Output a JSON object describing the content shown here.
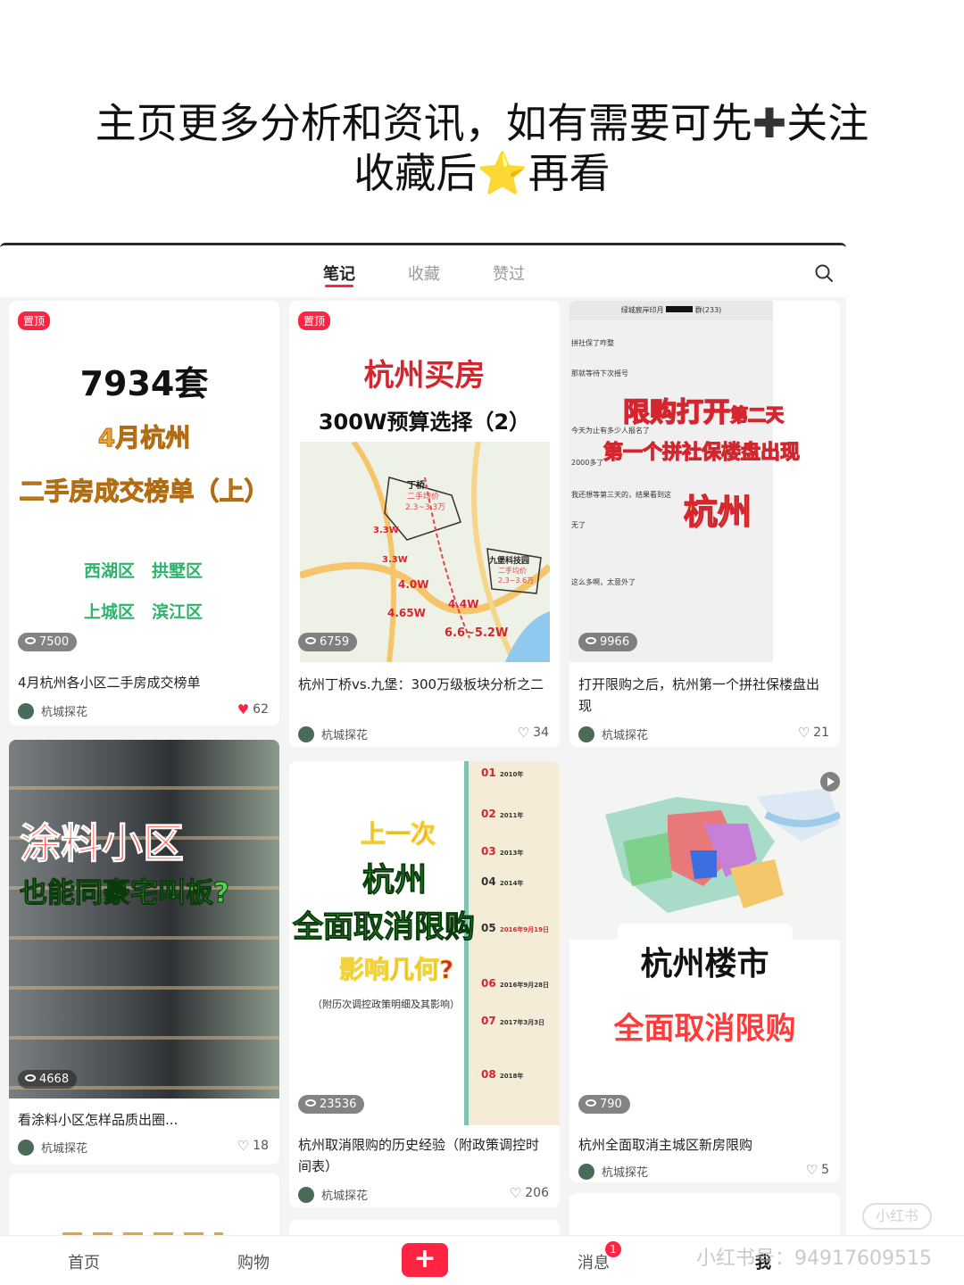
{
  "banner": {
    "line1_a": "主页更多分析和资讯，如有需要可先",
    "line1_plus": "✚",
    "line1_b": "关注",
    "line2_a": "收藏后",
    "line2_star": "⭐",
    "line2_b": "再看"
  },
  "tabs": [
    "笔记",
    "收藏",
    "赞过"
  ],
  "search_icon": "search-icon",
  "cards": [
    {
      "pin": "置顶",
      "cover": {
        "big": "7934套",
        "sub1": "4月杭州",
        "sub2": "二手房成交榜单（上）",
        "d1": "西湖区",
        "d2": "拱墅区",
        "d3": "上城区",
        "d4": "滨江区"
      },
      "views": "7500",
      "title": "4月杭州各小区二手房成交榜单",
      "author": "杭城探花",
      "likes": "62"
    },
    {
      "pin": "置顶",
      "cover": {
        "big": "杭州买房",
        "sub": "300W预算选择（2）",
        "m1": "丁桥",
        "m2": "二手均价",
        "m3": "2.3~3.3万",
        "m4": "3.3W",
        "m5": "3.3W",
        "m6": "4.0W",
        "m7": "4.65W",
        "m8": "4.4W",
        "m9": "6.6~5.2W",
        "m10": "九堡科技园",
        "m11": "二手均价",
        "m12": "2.3~3.6万"
      },
      "views": "6759",
      "title": "杭州丁桥vs.九堡：300万级板块分析之二",
      "author": "杭城探花",
      "likes": "34"
    },
    {
      "cover": {
        "chat_header": "绿城宸岸印月",
        "chat_group": "群(233)",
        "c1": "拼社保了咋整",
        "c2": "那就等待下次摇号",
        "c3": "今天为止有多少人报名了",
        "c4": "2000多了",
        "c5": "我还想等第三天的，结果看到这",
        "c6": "无了",
        "c7": "这么多啊，太意外了",
        "h1": "限购打开",
        "h1b": "第二天",
        "h2": "第一个拼社保楼盘出现",
        "h3": "杭州"
      },
      "views": "9966",
      "title": "打开限购之后，杭州第一个拼社保楼盘出现",
      "author": "杭城探花",
      "likes": "21"
    },
    {
      "cover": {
        "h1": "涂料小区",
        "h2": "也能同豪宅叫板?"
      },
      "views": "4668",
      "title": "看涂料小区怎样品质出圈...",
      "author": "杭城探花",
      "likes": "18"
    },
    {
      "cover": {
        "h1": "上一次",
        "h2": "杭州",
        "h3": "全面取消限购",
        "h4": "影响几何?",
        "note": "（附历次调控政策明细及其影响）",
        "t1": "01",
        "t1y": "2010年",
        "t2": "02",
        "t2y": "2011年",
        "t3": "03",
        "t3y": "2013年",
        "t4": "04",
        "t4y": "2014年",
        "t5": "05",
        "t5y": "2016年9月19日",
        "t6": "06",
        "t6y": "2016年9月28日",
        "t7": "07",
        "t7y": "2017年3月3日",
        "t8": "08",
        "t8y": "2018年"
      },
      "views": "23536",
      "title": "杭州取消限购的历史经验（附政策调控时间表）",
      "author": "杭城探花",
      "likes": "206"
    },
    {
      "cover": {
        "h1": "杭州楼市",
        "h2": "全面取消限购"
      },
      "views": "790",
      "title": "杭州全面取消主城区新房限购",
      "author": "杭城探花",
      "likes": "5"
    }
  ],
  "bottom_nav": {
    "home": "首页",
    "shop": "购物",
    "plus": "+",
    "msg": "消息",
    "msg_badge": "1",
    "me": "我"
  },
  "watermark": "小红书号：949176095​15",
  "watermark_logo": "小红书"
}
